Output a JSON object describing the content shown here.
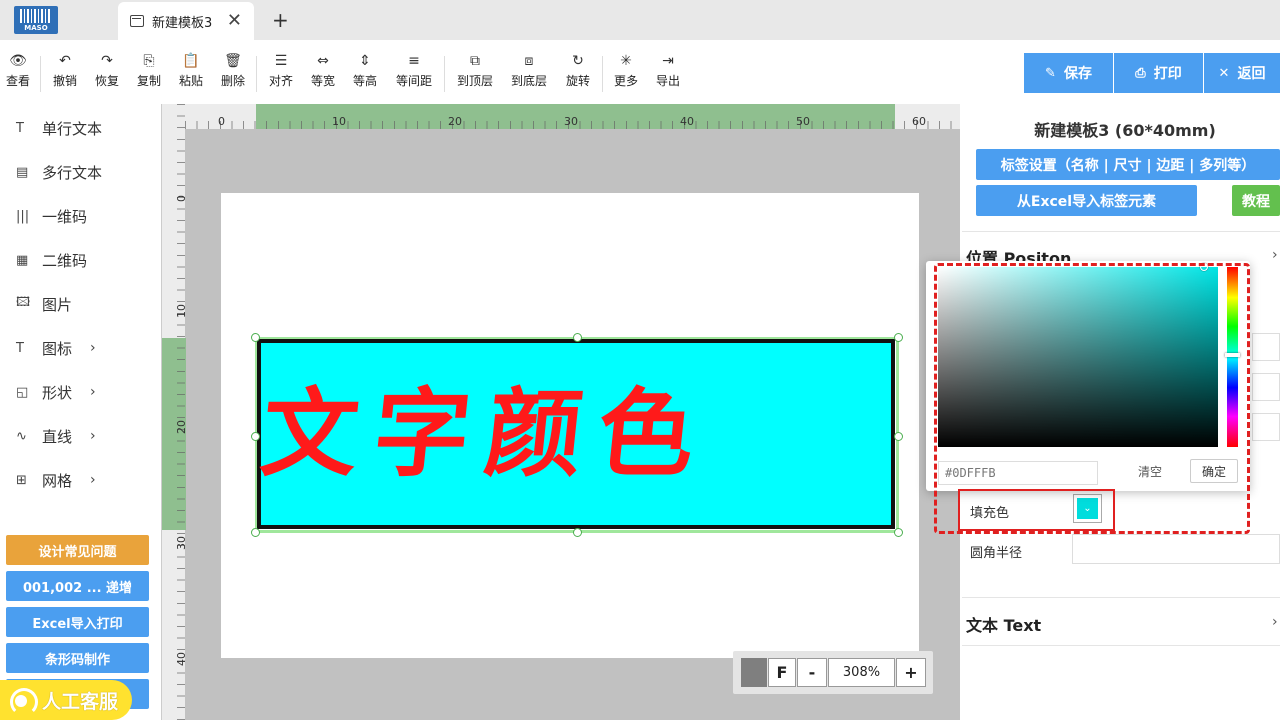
{
  "app": {
    "logo_text": "MASO",
    "tab_title": "新建模板3",
    "tab_close": "✕",
    "new_tab": "+"
  },
  "toolbar": {
    "items": [
      {
        "label": "查看",
        "icon": "👁"
      },
      {
        "label": "撤销",
        "icon": "↶"
      },
      {
        "label": "恢复",
        "icon": "↷"
      },
      {
        "label": "复制",
        "icon": "⎘"
      },
      {
        "label": "粘贴",
        "icon": "📋"
      },
      {
        "label": "删除",
        "icon": "🗑"
      },
      {
        "label": "对齐",
        "icon": "☰"
      },
      {
        "label": "等宽",
        "icon": "⇔"
      },
      {
        "label": "等高",
        "icon": "⇕"
      },
      {
        "label": "等间距",
        "icon": "≡"
      },
      {
        "label": "到顶层",
        "icon": "⧉"
      },
      {
        "label": "到底层",
        "icon": "⧈"
      },
      {
        "label": "旋转",
        "icon": "↻"
      },
      {
        "label": "更多",
        "icon": "✳"
      },
      {
        "label": "导出",
        "icon": "⇥"
      }
    ],
    "save_label": "保存",
    "print_label": "打印",
    "back_label": "返回",
    "save_icon": "✎",
    "print_icon": "⎙",
    "back_icon": "✕"
  },
  "sidebar": {
    "items": [
      {
        "label": "单行文本",
        "icon": "T"
      },
      {
        "label": "多行文本",
        "icon": "▤"
      },
      {
        "label": "一维码",
        "icon": "|||"
      },
      {
        "label": "二维码",
        "icon": "▦"
      },
      {
        "label": "图片",
        "icon": "🖾"
      },
      {
        "label": "图标",
        "icon": "T"
      },
      {
        "label": "形状",
        "icon": "◱"
      },
      {
        "label": "直线",
        "icon": "∿"
      },
      {
        "label": "网格",
        "icon": "⊞"
      }
    ],
    "chevron": "›",
    "buttons": [
      {
        "label": "设计常见问题",
        "color": "#e9a33b"
      },
      {
        "label": "001,002 ... 递增",
        "color": "#4b9ef0"
      },
      {
        "label": "Excel导入打印",
        "color": "#4b9ef0"
      },
      {
        "label": "条形码制作",
        "color": "#4b9ef0"
      }
    ],
    "service_label": "人工客服"
  },
  "canvas": {
    "h_ruler_labels": [
      "0",
      "10",
      "20",
      "30",
      "40",
      "50",
      "60"
    ],
    "v_ruler_labels": [
      "0",
      "10",
      "20",
      "30",
      "40"
    ],
    "element_text": "文字颜色",
    "element_fill": "#00ffff",
    "element_text_color": "#ff1a1a",
    "zoom": {
      "f_label": "F",
      "minus": "-",
      "value": "308%",
      "plus": "+"
    }
  },
  "right_panel": {
    "title": "新建模板3 (60*40mm)",
    "label_settings_button": "标签设置（名称 | 尺寸 | 边距 | 多列等）",
    "excel_import_button": "从Excel导入标签元素",
    "tutorial_button": "教程",
    "section_position": "位置 Positon",
    "section_text": "文本 Text",
    "fill_label": "填充色",
    "radius_label": "圆角半径",
    "picker": {
      "hex_value": "#0DFFFB",
      "clear_label": "清空",
      "confirm_label": "确定"
    }
  }
}
